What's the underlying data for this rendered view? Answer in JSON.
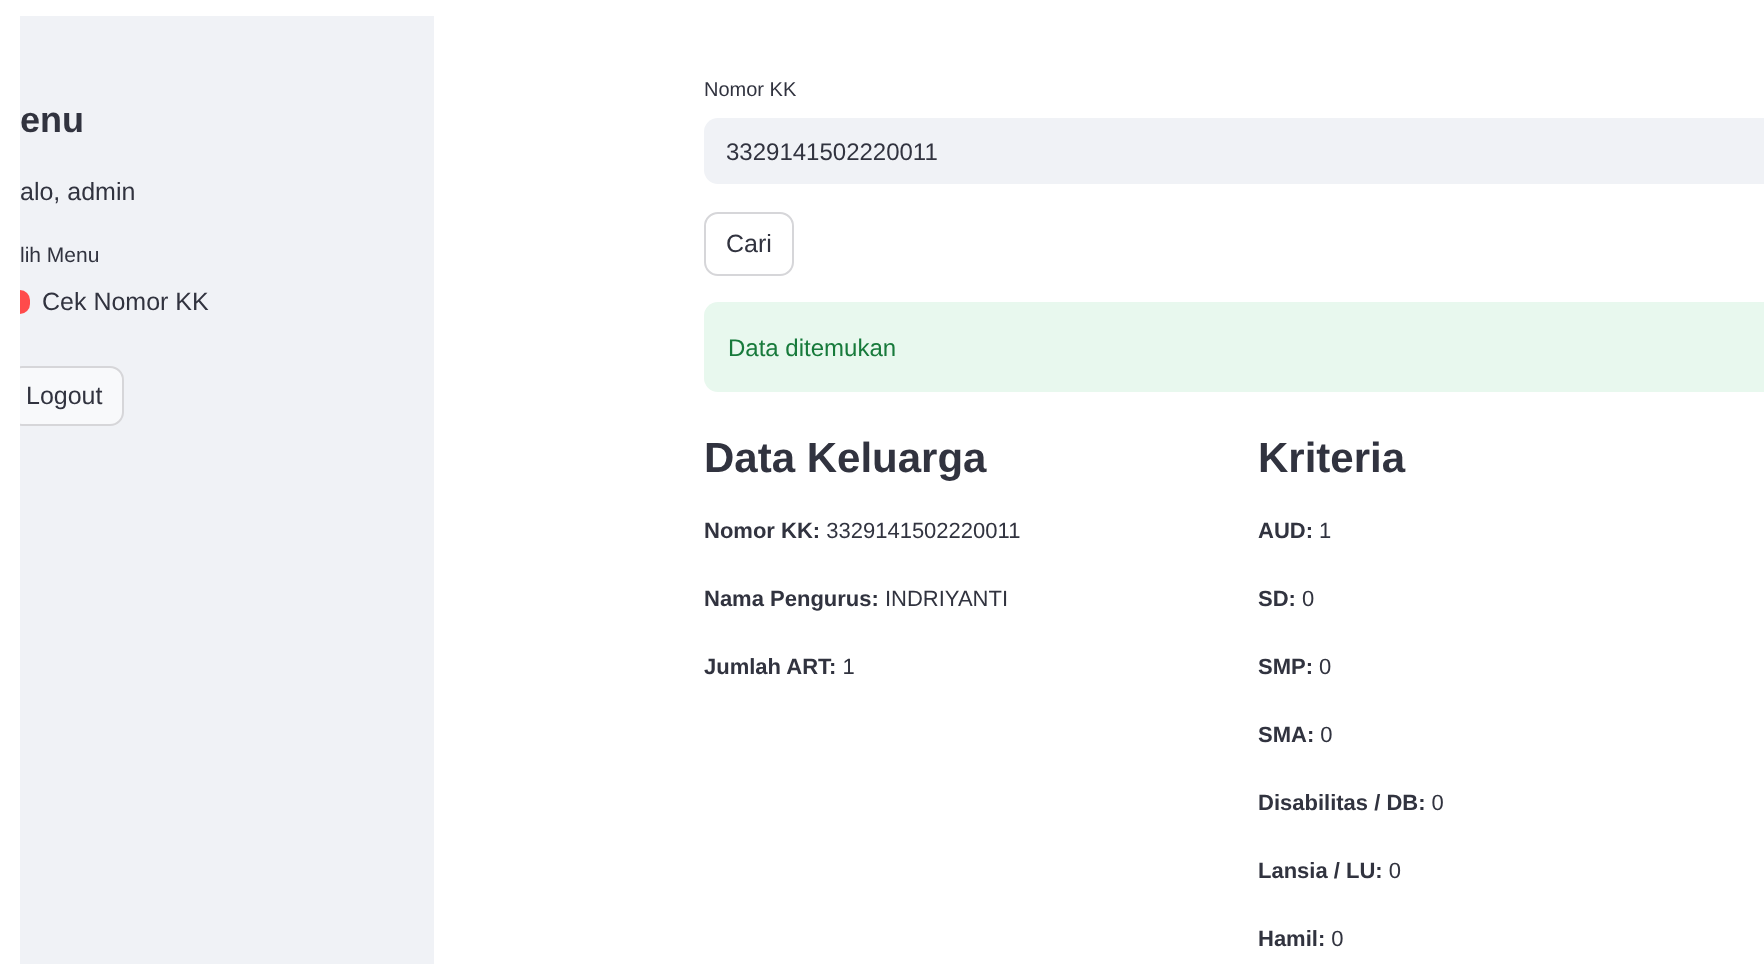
{
  "sidebar": {
    "title": "enu",
    "greeting": "alo, admin",
    "radio_label": "lih Menu",
    "options": [
      {
        "label": "Cek Nomor KK",
        "selected": true
      }
    ],
    "logout": "Logout"
  },
  "form": {
    "label": "Nomor KK",
    "value": "3329141502220011",
    "button": "Cari"
  },
  "alert": {
    "text": "Data ditemukan"
  },
  "keluarga": {
    "title": "Data Keluarga",
    "items": [
      "**Nomor KK:** 3329141502220011",
      "**Nama Pengurus:** INDRIYANTI",
      "**Jumlah ART:** 1"
    ]
  },
  "kriteria": {
    "title": "Kriteria",
    "items": [
      "**AUD:** 1",
      "**SD:** 0",
      "**SMP:** 0",
      "**SMA:** 0",
      "**Disabilitas / DB:** 0",
      "**Lansia / LU:** 0",
      "**Hamil:** 0"
    ]
  }
}
